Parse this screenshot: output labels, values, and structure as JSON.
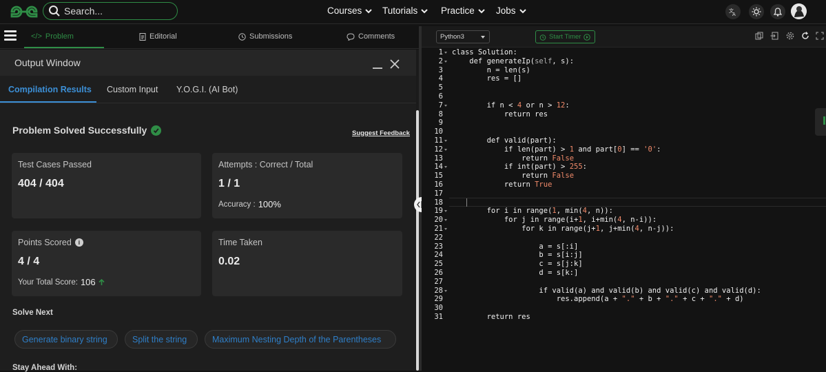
{
  "topnav": {
    "search_placeholder": "Search...",
    "links": [
      "Courses",
      "Tutorials",
      "Practice",
      "Jobs"
    ]
  },
  "problem_tabs": [
    "Problem",
    "Editorial",
    "Submissions",
    "Comments"
  ],
  "output_window": {
    "title": "Output Window",
    "tabs": [
      "Compilation Results",
      "Custom Input",
      "Y.O.G.I. (AI Bot)"
    ],
    "status": "Problem Solved Successfully",
    "suggest_feedback": "Suggest Feedback",
    "cards": {
      "test_cases_label": "Test Cases Passed",
      "test_cases_value": "404 / 404",
      "attempts_label": "Attempts : Correct / Total",
      "attempts_value": "1 / 1",
      "accuracy_label": "Accuracy :",
      "accuracy_value": "100%",
      "points_label": "Points Scored",
      "points_value": "4 / 4",
      "total_score_label": "Your Total Score:",
      "total_score_value": "106",
      "time_label": "Time Taken",
      "time_value": "0.02"
    },
    "solve_next_heading": "Solve Next",
    "solve_next": [
      "Generate binary string",
      "Split the string",
      "Maximum Nesting Depth of the Parentheses"
    ],
    "stay_ahead_heading": "Stay Ahead With:"
  },
  "editor": {
    "language": "Python3",
    "timer_label": "Start Timer",
    "line_numbers": [
      "1",
      "2",
      "3",
      "4",
      "5",
      "6",
      "7",
      "8",
      "9",
      "10",
      "11",
      "12",
      "13",
      "14",
      "15",
      "16",
      "17",
      "18",
      "19",
      "20",
      "21",
      "22",
      "23",
      "24",
      "25",
      "26",
      "27",
      "28",
      "29",
      "30",
      "31"
    ],
    "code_lines": [
      "class Solution:",
      "    def generateIp(self, s):",
      "        n = len(s)",
      "        res = []",
      "",
      "",
      "        if n < 4 or n > 12:",
      "            return res",
      "",
      "",
      "        def valid(part):",
      "            if len(part) > 1 and part[0] == '0':",
      "                return False",
      "            if int(part) > 255:",
      "                return False",
      "            return True",
      "",
      "",
      "        for i in range(1, min(4, n)):",
      "            for j in range(i+1, i+min(4, n-i)):",
      "                for k in range(j+1, j+min(4, n-j)):",
      "",
      "                    a = s[:i]",
      "                    b = s[i:j]",
      "                    c = s[j:k]",
      "                    d = s[k:]",
      "",
      "                    if valid(a) and valid(b) and valid(c) and valid(d):",
      "                        res.append(a + \".\" + b + \".\" + c + \".\" + d)",
      "",
      "        return res"
    ]
  },
  "colors": {
    "brand_green": "#2f8d46",
    "link_blue": "#3c8fd6",
    "code_literal": "#f08a6a"
  }
}
